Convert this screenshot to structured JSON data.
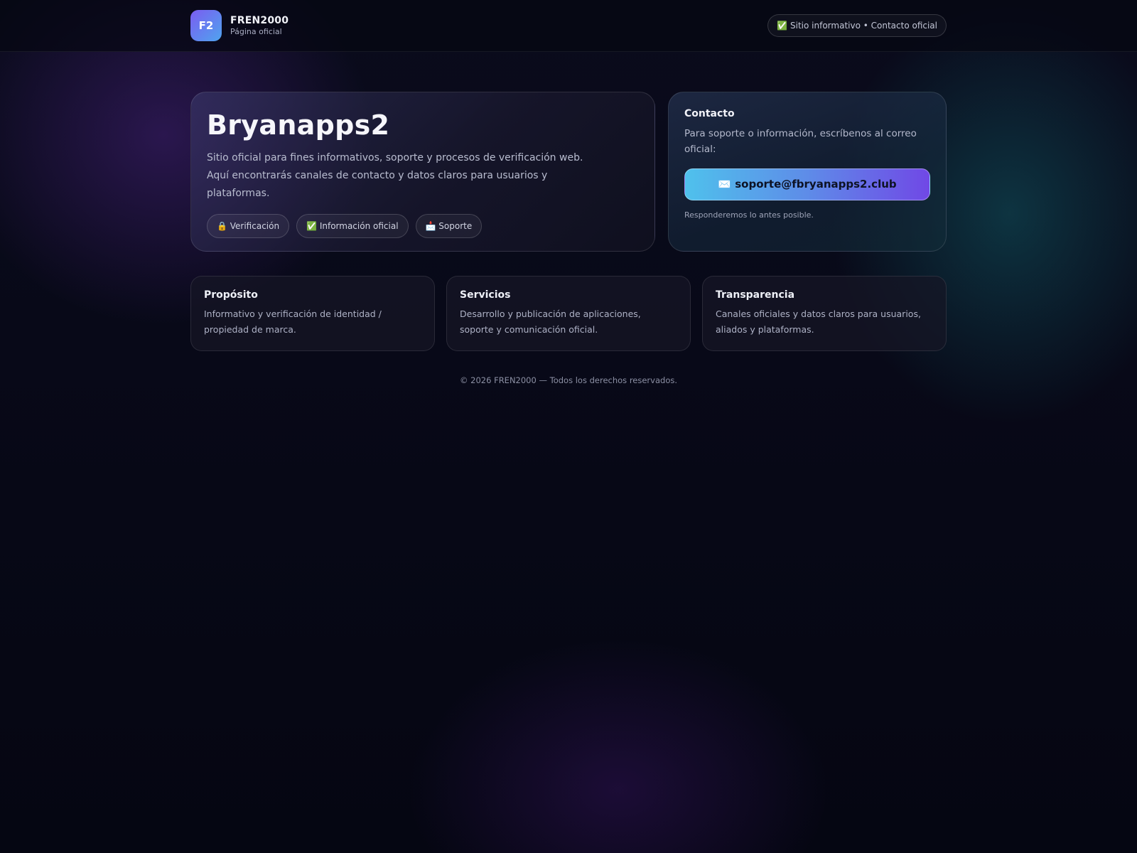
{
  "header": {
    "logo_text": "F2",
    "brand_name": "FREN2000",
    "brand_sub": "Página oficial",
    "badge": "✅ Sitio informativo • Contacto oficial"
  },
  "hero": {
    "title": "Bryanapps2",
    "description": "Sitio oficial para fines informativos, soporte y procesos de verificación web. Aquí encontrarás canales de contacto y datos claros para usuarios y plataformas.",
    "pills": [
      "🔒 Verificación",
      "✅ Información oficial",
      "📩 Soporte"
    ]
  },
  "contact": {
    "title": "Contacto",
    "text": "Para soporte o información, escríbenos al correo oficial:",
    "email_button": "✉️ soporte@fbryanapps2.club",
    "note": "Responderemos lo antes posible."
  },
  "cards": [
    {
      "title": "Propósito",
      "text": "Informativo y verificación de identidad / propiedad de marca."
    },
    {
      "title": "Servicios",
      "text": "Desarrollo y publicación de aplicaciones, soporte y comunicación oficial."
    },
    {
      "title": "Transparencia",
      "text": "Canales oficiales y datos claros para usuarios, aliados y plataformas."
    }
  ],
  "footer": {
    "text": "© 2026 FREN2000 — Todos los derechos reservados."
  },
  "colors": {
    "background": "#070816",
    "accent_start": "#4fc1ec",
    "accent_end": "#7048e6",
    "logo_start": "#7b5cf0",
    "logo_end": "#4fa4ef"
  }
}
